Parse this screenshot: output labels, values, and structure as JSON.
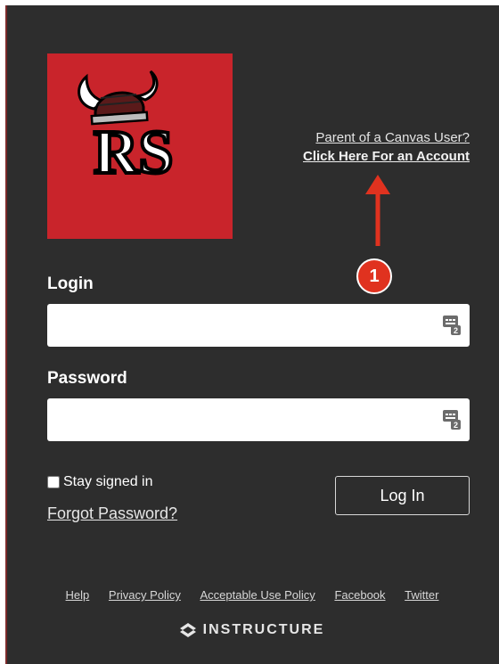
{
  "header": {
    "parent_link_line1": "Parent of a Canvas User?",
    "parent_link_line2": "Click Here For an Account"
  },
  "annotation": {
    "badge_number": "1",
    "color": "#e0321f"
  },
  "logo": {
    "letters": "RS",
    "background": "#c9242b",
    "icon": "viking-helmet-icon"
  },
  "form": {
    "login_label": "Login",
    "login_value": "",
    "password_label": "Password",
    "password_value": "",
    "stay_signed_in_label": "Stay signed in",
    "stay_signed_in_checked": false,
    "forgot_password": "Forgot Password?",
    "submit_label": "Log In"
  },
  "footer": {
    "links": [
      "Help",
      "Privacy Policy",
      "Acceptable Use Policy",
      "Facebook",
      "Twitter"
    ],
    "brand": "INSTRUCTURE"
  }
}
